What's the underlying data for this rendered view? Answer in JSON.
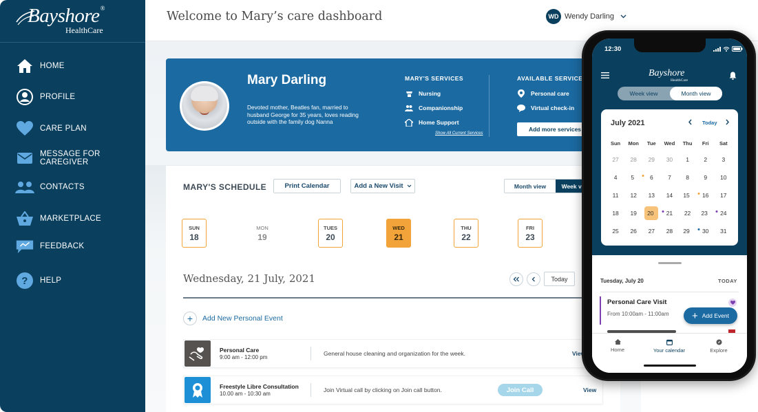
{
  "brand": {
    "name": "Bayshore",
    "registered": "®",
    "sub": "HealthCare"
  },
  "nav": [
    {
      "label": "HOME",
      "icon": "home-icon"
    },
    {
      "label": "PROFILE",
      "icon": "user-icon"
    },
    {
      "label": "CARE PLAN",
      "icon": "heart-icon"
    },
    {
      "label": "MESSAGE FOR CAREGIVER",
      "icon": "mail-icon"
    },
    {
      "label": "CONTACTS",
      "icon": "contacts-icon"
    },
    {
      "label": "MARKETPLACE",
      "icon": "basket-icon"
    },
    {
      "label": "FEEDBACK",
      "icon": "feedback-icon"
    },
    {
      "label": "HELP",
      "icon": "help-icon"
    }
  ],
  "header": {
    "title": "Welcome to Mary’s care dashboard",
    "user_initials": "WD",
    "user_name": "Wendy Darling"
  },
  "profile": {
    "name": "Mary Darling",
    "bio": "Devoted mother, Beatles fan, married to husband George for 35 years, loves reading outside with the family dog Nanna",
    "services_title": "MARY'S SERVICES",
    "services": [
      "Nursing",
      "Companionship",
      "Home Support"
    ],
    "show_all": "Show All Current Services",
    "available_title": "AVAILABLE SERVICES",
    "available": [
      "Personal care",
      "Virtual check-in"
    ],
    "add_services": "Add more services"
  },
  "schedule": {
    "title": "MARY'S SCHEDULE",
    "print": "Print Calendar",
    "add_visit": "Add a New Visit",
    "month_view": "Month view",
    "week_view": "Week view",
    "days": [
      {
        "name": "SUN",
        "num": "18",
        "state": "outlined"
      },
      {
        "name": "MON",
        "num": "19",
        "state": "plain"
      },
      {
        "name": "TUES",
        "num": "20",
        "state": "outlined"
      },
      {
        "name": "WED",
        "num": "21",
        "state": "active"
      },
      {
        "name": "THU",
        "num": "22",
        "state": "outlined"
      },
      {
        "name": "FRI",
        "num": "23",
        "state": "outlined"
      }
    ],
    "date_heading": "Wednesday, 21 July, 2021",
    "today": "Today",
    "add_event": "Add New Personal Event",
    "events": [
      {
        "name": "Personal Care",
        "time": "9:00 am - 12:00 pm",
        "desc": "General house cleaning and organization for the week.",
        "view": "View"
      },
      {
        "name": "Freestyle Libre Consultation",
        "time": "10.00 am - 10:30 am",
        "desc": "Join Virtual call by clicking on Join call button.",
        "join": "Join Call",
        "view": "View"
      }
    ]
  },
  "phone": {
    "time": "12:30",
    "brand": "Bayshore",
    "brand_sub": "HealthCare",
    "week_view": "Week view",
    "month_view": "Month view",
    "month": "July 2021",
    "today": "Today",
    "dow": [
      "Sun",
      "Mon",
      "Tue",
      "Wed",
      "Thu",
      "Fri",
      "Sat"
    ],
    "weeks": [
      [
        "27",
        "28",
        "29",
        "30",
        "1",
        "2",
        "3"
      ],
      [
        "4",
        "5",
        "6",
        "7",
        "8",
        "9",
        "10"
      ],
      [
        "11",
        "12",
        "13",
        "14",
        "15",
        "16",
        "17"
      ],
      [
        "18",
        "19",
        "20",
        "21",
        "22",
        "23",
        "24"
      ],
      [
        "25",
        "26",
        "27",
        "28",
        "29",
        "30",
        "31"
      ]
    ],
    "selected_date": "20",
    "sheet_date": "Tuesday, July 20",
    "sheet_today": "TODAY",
    "event_title": "Personal Care Visit",
    "event_time": "From 10:00am - 11:00am",
    "add_event": "Add Event",
    "tabs": [
      "Home",
      "Your calendar",
      "Explore"
    ]
  },
  "colors": {
    "sidebar": "#0a3f5e",
    "banner": "#1b6aa1",
    "accent_orange": "#f2a33a",
    "join_call": "#a5d6ea",
    "event_purple": "#7b3fb2"
  }
}
